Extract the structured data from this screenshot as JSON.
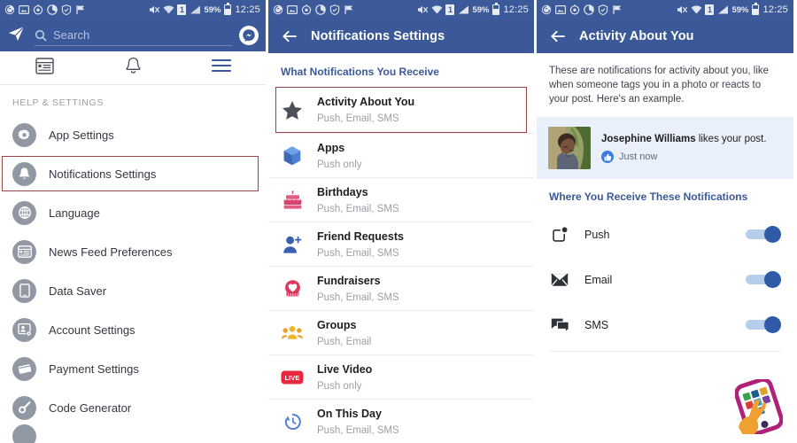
{
  "status_bar": {
    "icons": [
      "sync-icon",
      "screenshot-icon",
      "timer-icon",
      "data-usage-icon",
      "shield-icon",
      "flag-icon"
    ],
    "right_icons": [
      "mute-icon",
      "wifi-icon",
      "sim-icon",
      "signal-icon"
    ],
    "sim_label": "1",
    "battery_percent": "59%",
    "time": "12:25"
  },
  "panel_left": {
    "search": {
      "placeholder": "Search",
      "icon": "search-icon"
    },
    "compose_icon": "paper-plane-icon",
    "messenger_icon": "messenger-icon",
    "tabs": [
      {
        "name": "news-feed",
        "icon": "news-feed-icon",
        "active": false
      },
      {
        "name": "notifications",
        "icon": "bell-icon",
        "active": false
      },
      {
        "name": "menu",
        "icon": "hamburger-icon",
        "active": true
      }
    ],
    "section_label": "HELP & SETTINGS",
    "items": [
      {
        "label": "App Settings",
        "icon": "gear-icon",
        "highlighted": false
      },
      {
        "label": "Notifications Settings",
        "icon": "bell-icon",
        "highlighted": true
      },
      {
        "label": "Language",
        "icon": "globe-icon",
        "highlighted": false
      },
      {
        "label": "News Feed Preferences",
        "icon": "news-feed-icon",
        "highlighted": false
      },
      {
        "label": "Data Saver",
        "icon": "phone-icon",
        "highlighted": false
      },
      {
        "label": "Account Settings",
        "icon": "account-icon",
        "highlighted": false
      },
      {
        "label": "Payment Settings",
        "icon": "card-icon",
        "highlighted": false
      },
      {
        "label": "Code Generator",
        "icon": "key-icon",
        "highlighted": false
      }
    ]
  },
  "panel_middle": {
    "title": "Notifications Settings",
    "back_icon": "back-arrow-icon",
    "section_heading": "What Notifications You Receive",
    "items": [
      {
        "label": "Activity About You",
        "sub": "Push, Email, SMS",
        "icon": "star-icon",
        "highlighted": true
      },
      {
        "label": "Apps",
        "sub": "Push only",
        "icon": "apps-cube-icon",
        "highlighted": false
      },
      {
        "label": "Birthdays",
        "sub": "Push, Email, SMS",
        "icon": "cake-icon",
        "highlighted": false
      },
      {
        "label": "Friend Requests",
        "sub": "Push, Email, SMS",
        "icon": "friend-request-icon",
        "highlighted": false
      },
      {
        "label": "Fundraisers",
        "sub": "Push, Email, SMS",
        "icon": "fundraiser-heart-icon",
        "highlighted": false
      },
      {
        "label": "Groups",
        "sub": "Push, Email",
        "icon": "groups-icon",
        "highlighted": false
      },
      {
        "label": "Live Video",
        "sub": "Push only",
        "icon": "live-badge-icon",
        "highlighted": false
      },
      {
        "label": "On This Day",
        "sub": "Push, Email, SMS",
        "icon": "clock-history-icon",
        "highlighted": false
      }
    ]
  },
  "panel_right": {
    "title": "Activity About You",
    "back_icon": "back-arrow-icon",
    "description": "These are notifications for activity about you, like when someone tags you in a photo or reacts to your post. Here's an example.",
    "example": {
      "avatar_icon": "user-photo",
      "actor": "Josephine Williams",
      "action": " likes your post.",
      "reaction_icon": "thumbs-up-icon",
      "time": "Just now"
    },
    "section_heading": "Where You Receive These Notifications",
    "toggles": [
      {
        "label": "Push",
        "icon": "push-notification-icon",
        "on": true
      },
      {
        "label": "Email",
        "icon": "envelope-icon",
        "on": true
      },
      {
        "label": "SMS",
        "icon": "sms-bubble-icon",
        "on": true
      }
    ],
    "watermark_icon": "phone-wrench-logo"
  },
  "colors": {
    "facebook_blue": "#3b5998",
    "status_blue": "#3c5a99",
    "highlight_red": "#9e4444",
    "card_blue": "#e9f0fa",
    "toggle_on": "#2e5aa8"
  }
}
